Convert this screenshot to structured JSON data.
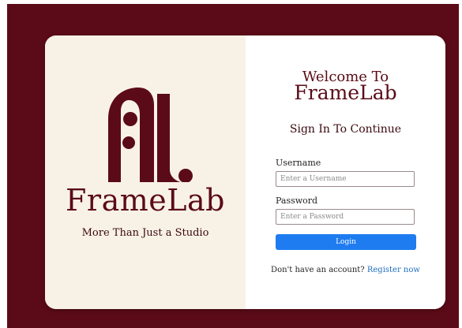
{
  "brand": {
    "name": "FrameLab",
    "tagline": "More Than Just a Studio"
  },
  "colors": {
    "background": "#5b0b17",
    "panel_left": "#f8f2e6",
    "accent": "#5b0b17",
    "button": "#1e7cf0",
    "link": "#1e6fbf"
  },
  "login": {
    "welcome_line": "Welcome To",
    "welcome_brand": "FrameLab",
    "subtitle": "Sign In To Continue",
    "username_label": "Username",
    "username_placeholder": "Enter a Username",
    "password_label": "Password",
    "password_placeholder": "Enter a Password",
    "button_label": "Login",
    "signup_prompt": "Don't have an account?",
    "signup_link": "Register now"
  },
  "icons": {
    "logo": "framelab-logo-icon"
  }
}
